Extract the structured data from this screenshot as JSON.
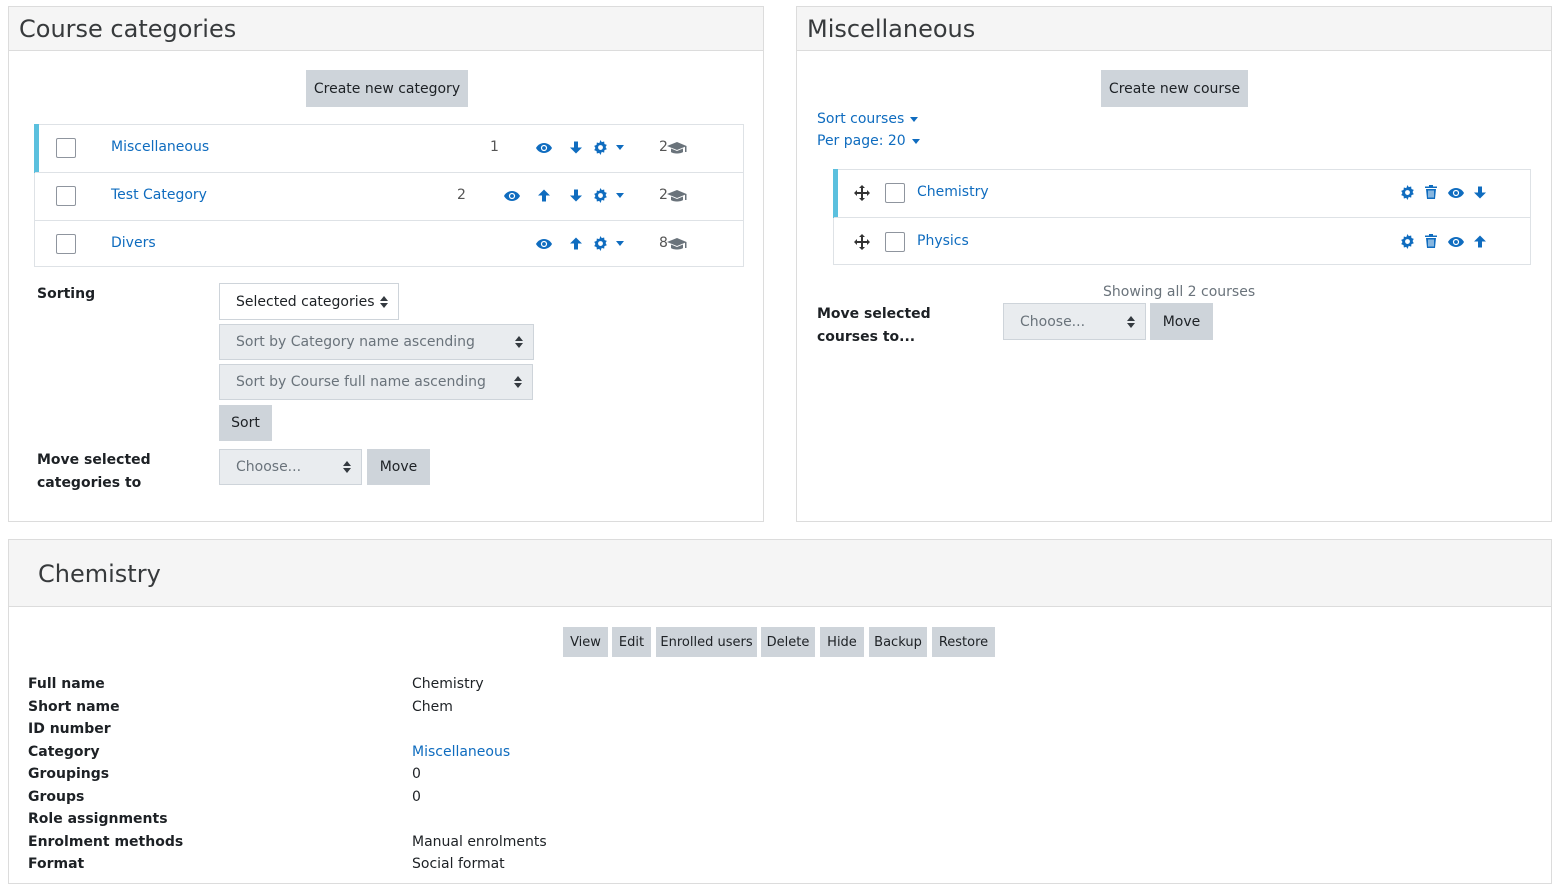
{
  "categories_panel": {
    "title": "Course categories",
    "create_button": "Create new category",
    "items": [
      {
        "name": "Miscellaneous",
        "sortorder": "1",
        "course_count": "2"
      },
      {
        "name": "Test Category",
        "sortorder": "2",
        "course_count": "2"
      },
      {
        "name": "Divers",
        "sortorder": "",
        "course_count": "8"
      }
    ],
    "sorting_label": "Sorting",
    "sort_scope_select": "Selected categories",
    "sort_category_select": "Sort by Category name ascending",
    "sort_course_select": "Sort by Course full name ascending",
    "sort_button": "Sort",
    "move_label_line1": "Move selected",
    "move_label_line2": "categories to",
    "move_select": "Choose...",
    "move_button": "Move"
  },
  "courses_panel": {
    "title": "Miscellaneous",
    "create_button": "Create new course",
    "sort_courses_link": "Sort courses",
    "per_page_link": "Per page: 20",
    "courses": [
      {
        "name": "Chemistry"
      },
      {
        "name": "Physics"
      }
    ],
    "showing_text": "Showing all 2 courses",
    "move_label_line1": "Move selected",
    "move_label_line2": "courses to...",
    "move_select": "Choose...",
    "move_button": "Move"
  },
  "detail_panel": {
    "title": "Chemistry",
    "actions": [
      "View",
      "Edit",
      "Enrolled users",
      "Delete",
      "Hide",
      "Backup",
      "Restore"
    ],
    "fields": [
      {
        "label": "Full name",
        "value": "Chemistry"
      },
      {
        "label": "Short name",
        "value": "Chem"
      },
      {
        "label": "ID number",
        "value": ""
      },
      {
        "label": "Category",
        "value": "Miscellaneous"
      },
      {
        "label": "Groupings",
        "value": "0"
      },
      {
        "label": "Groups",
        "value": "0"
      },
      {
        "label": "Role assignments",
        "value": ""
      },
      {
        "label": "Enrolment methods",
        "value": "Manual enrolments"
      },
      {
        "label": "Format",
        "value": "Social format"
      }
    ]
  },
  "colors": {
    "link": "#0f6cbf",
    "highlight": "#5bc0de",
    "button": "#ced4da"
  }
}
